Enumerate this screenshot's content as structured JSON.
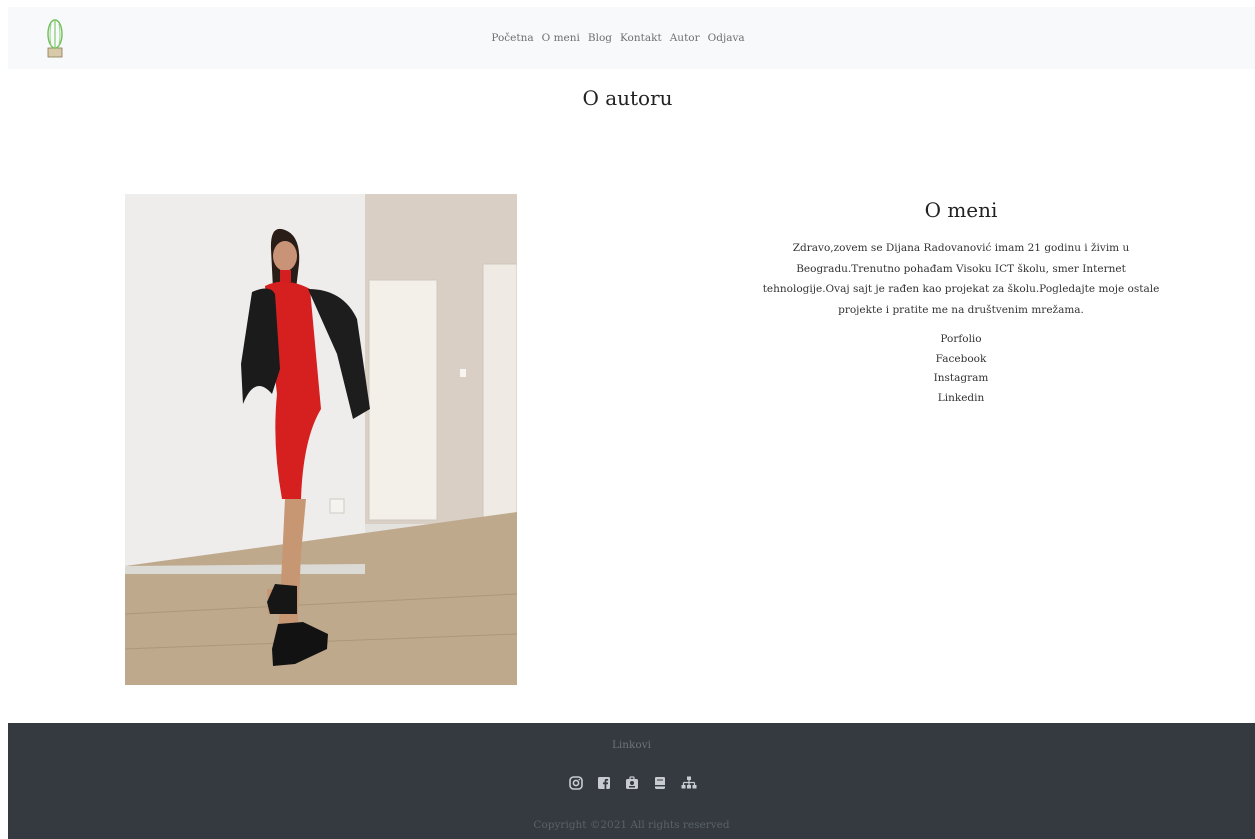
{
  "nav": {
    "logo_icon": "cactus-icon",
    "links": [
      "Početna",
      "O meni",
      "Blog",
      "Kontakt",
      "Autor",
      "Odjava"
    ]
  },
  "page_title": "O autoru",
  "about": {
    "heading": "O meni",
    "text": "Zdravo,zovem se Dijana Radovanović imam 21 godinu i živim u Beogradu.Trenutno pohađam Visoku ICT školu, smer Internet tehnologije.Ovaj sajt je rađen kao projekat za školu.Pogledajte moje ostale projekte i pratite me na društvenim mrežama.",
    "links": [
      "Porfolio",
      "Facebook",
      "Instagram",
      "Linkedin"
    ]
  },
  "footer": {
    "title": "Linkovi",
    "icons": [
      "instagram-icon",
      "facebook-icon",
      "portfolio-icon",
      "document-icon",
      "sitemap-icon"
    ],
    "copyright": "Copyright ©2021 All rights reserved"
  },
  "colors": {
    "navbar_bg": "#f8f9fa",
    "footer_bg": "#343a40",
    "dress_red": "#d61f1f"
  }
}
